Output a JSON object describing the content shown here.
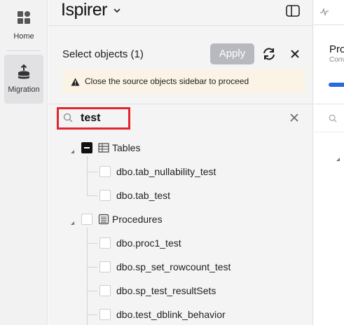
{
  "rail": {
    "home_label": "Home",
    "migration_label": "Migration"
  },
  "header": {
    "logo_text": "Ispirer"
  },
  "panel": {
    "title": "Select objects (1)",
    "apply_label": "Apply",
    "warning_text": "Close the source objects sidebar to proceed"
  },
  "search": {
    "value": "test"
  },
  "tree": {
    "groups": [
      {
        "label": "Tables",
        "check_state": "indeterminate",
        "children": [
          "dbo.tab_nullability_test",
          "dbo.tab_test"
        ]
      },
      {
        "label": "Procedures",
        "check_state": "unchecked",
        "children": [
          "dbo.proc1_test",
          "dbo.sp_set_rowcount_test",
          "dbo.sp_test_resultSets",
          "dbo.test_dblink_behavior"
        ]
      }
    ]
  },
  "right": {
    "title": "Pro",
    "subtitle": "Conv"
  },
  "colors": {
    "accent": "#2a6ae0",
    "highlight": "#e3262e",
    "warning_bg": "#fbf3e6"
  }
}
